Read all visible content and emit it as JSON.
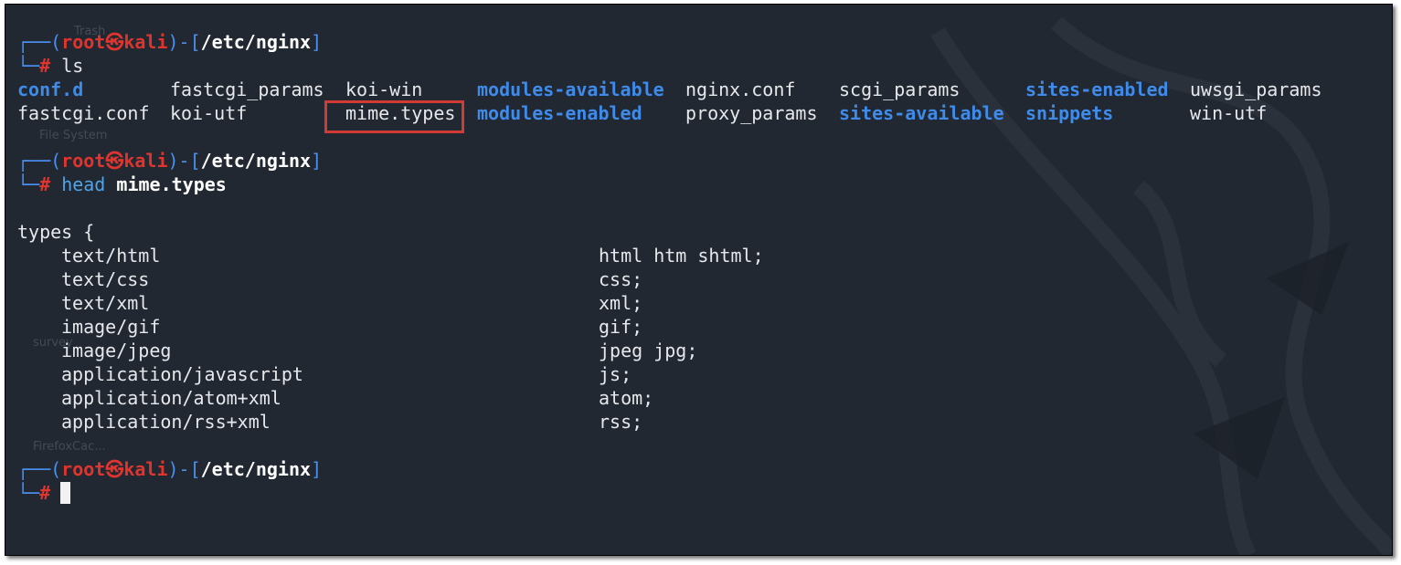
{
  "prompt": {
    "user": "root",
    "skull_glyph": "㉿",
    "host": "kali",
    "cwd": "/etc/nginx",
    "line1_prefix": "┌──(",
    "line1_mid": ")-[",
    "line1_end": "]",
    "line2_prefix": "└─",
    "hash": "#"
  },
  "commands": {
    "ls": "ls",
    "head_cmd": "head",
    "head_arg": "mime.types"
  },
  "ls_output": [
    {
      "name": "conf.d",
      "type": "dir"
    },
    {
      "name": "fastcgi_params",
      "type": "file"
    },
    {
      "name": "koi-win",
      "type": "file"
    },
    {
      "name": "modules-available",
      "type": "dir"
    },
    {
      "name": "nginx.conf",
      "type": "file"
    },
    {
      "name": "scgi_params",
      "type": "file"
    },
    {
      "name": "sites-enabled",
      "type": "dir"
    },
    {
      "name": "uwsgi_params",
      "type": "file"
    },
    {
      "name": "fastcgi.conf",
      "type": "file"
    },
    {
      "name": "koi-utf",
      "type": "file"
    },
    {
      "name": "mime.types",
      "type": "file",
      "highlighted": true
    },
    {
      "name": "modules-enabled",
      "type": "dir"
    },
    {
      "name": "proxy_params",
      "type": "file"
    },
    {
      "name": "sites-available",
      "type": "dir"
    },
    {
      "name": "snippets",
      "type": "dir"
    },
    {
      "name": "win-utf",
      "type": "file"
    }
  ],
  "head_output": {
    "open": "types {",
    "rows": [
      {
        "type": "text/html",
        "ext": "html htm shtml;"
      },
      {
        "type": "text/css",
        "ext": "css;"
      },
      {
        "type": "text/xml",
        "ext": "xml;"
      },
      {
        "type": "image/gif",
        "ext": "gif;"
      },
      {
        "type": "image/jpeg",
        "ext": "jpeg jpg;"
      },
      {
        "type": "application/javascript",
        "ext": "js;"
      },
      {
        "type": "application/atom+xml",
        "ext": "atom;"
      },
      {
        "type": "application/rss+xml",
        "ext": "rss;"
      }
    ]
  },
  "background_labels": [
    "Trash",
    "File System",
    "survey",
    "FirefoxCac..."
  ],
  "colors": {
    "background": "#222831",
    "directory": "#3f8bea",
    "prompt_red": "#e0342e",
    "highlight_box": "#d23a34",
    "text": "#e6e8ec"
  }
}
